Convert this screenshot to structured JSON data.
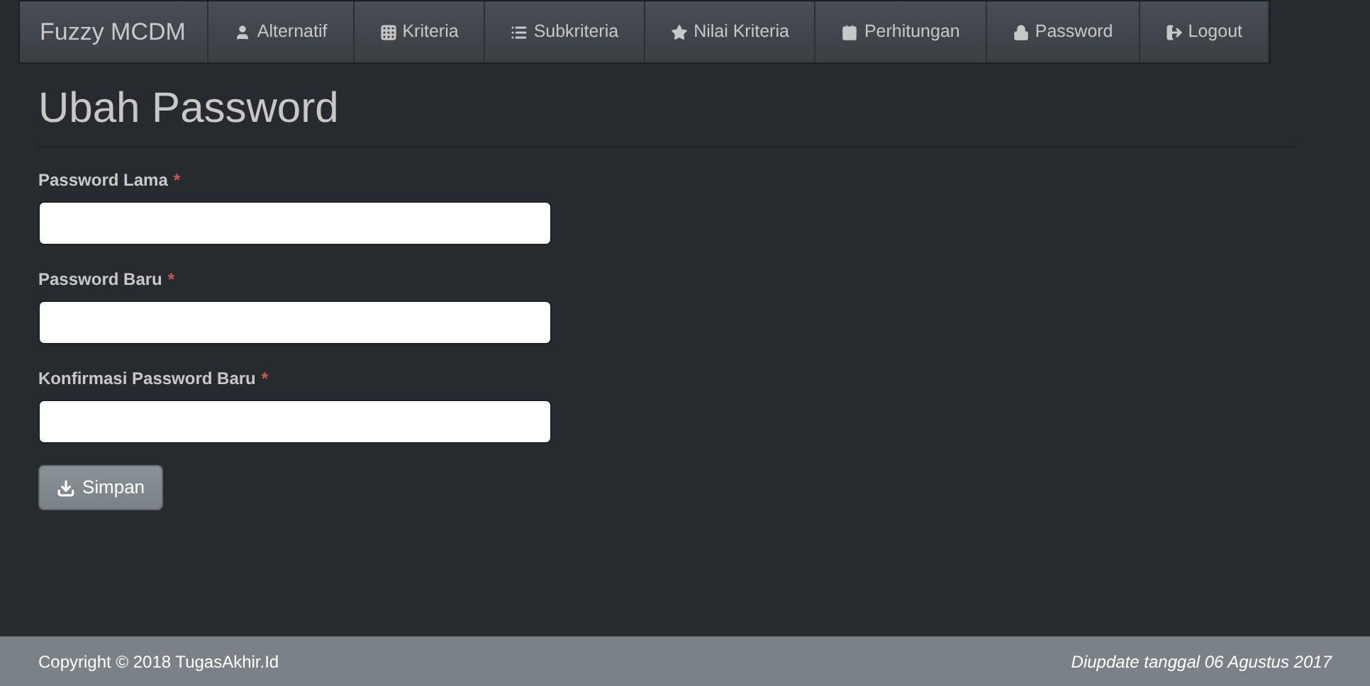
{
  "navbar": {
    "brand": "Fuzzy MCDM",
    "items": [
      {
        "label": "Alternatif",
        "selected": false
      },
      {
        "label": "Kriteria",
        "selected": false
      },
      {
        "label": "Subkriteria",
        "selected": false
      },
      {
        "label": "Nilai Kriteria",
        "selected": false
      },
      {
        "label": "Perhitungan",
        "selected": false
      },
      {
        "label": "Password",
        "selected": false
      },
      {
        "label": "Logout",
        "selected": false
      }
    ]
  },
  "page_title": "Ubah Password",
  "form": {
    "fields": [
      {
        "label": "Password Lama",
        "required_mark": "*"
      },
      {
        "label": "Password Baru",
        "required_mark": "*"
      },
      {
        "label": "Konfirmasi Password Baru",
        "required_mark": "*"
      }
    ],
    "submit": "Simpan"
  },
  "footer": {
    "copyright": "Copyright © 2018 TugasAkhir.Id",
    "updated": "Diupdate tanggal 06 Agustus 2017"
  }
}
